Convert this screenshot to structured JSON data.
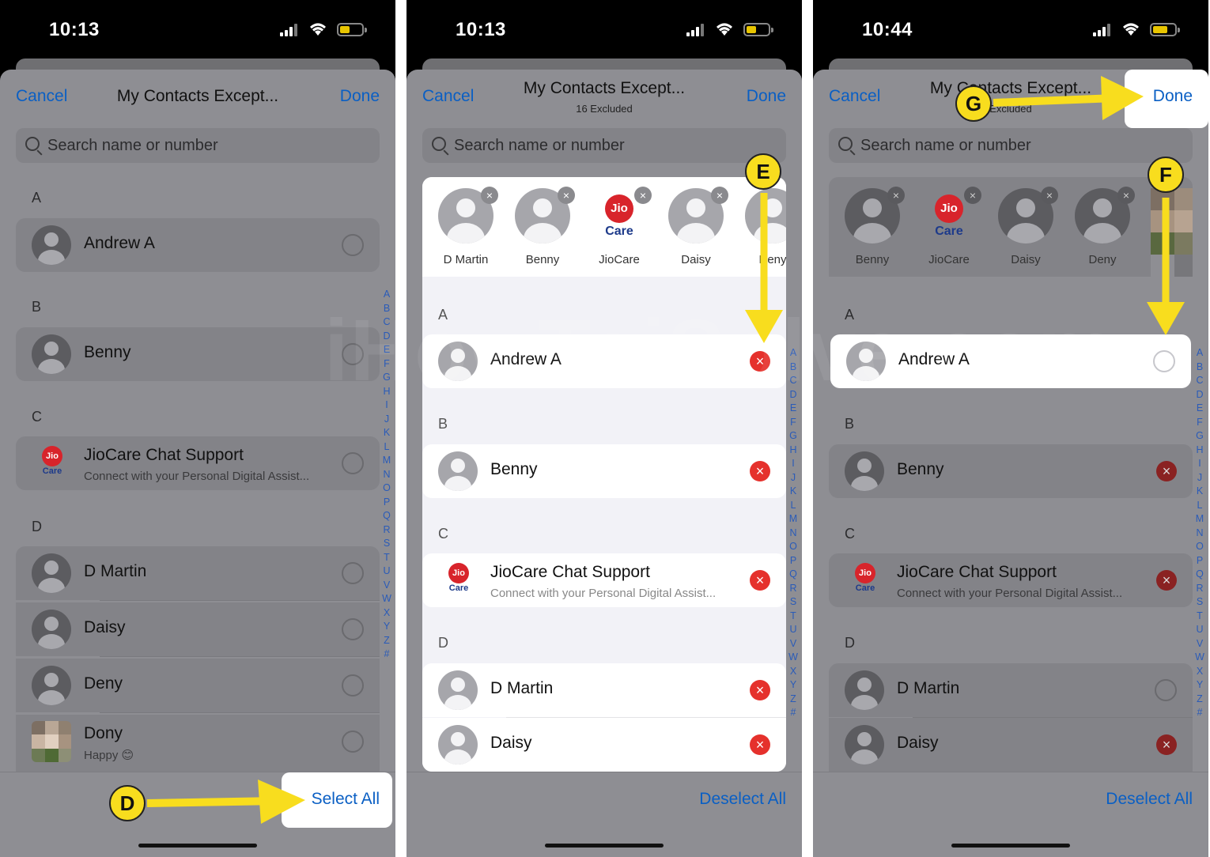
{
  "status_bar": {
    "panel1_time": "10:13",
    "panel2_time": "10:13",
    "panel3_time": "10:44"
  },
  "nav": {
    "cancel": "Cancel",
    "title": "My Contacts Except...",
    "done": "Done",
    "excluded_subtitle": "16 Excluded",
    "excluded_subtitle_partial": "Excluded"
  },
  "search": {
    "placeholder": "Search name or number"
  },
  "sections": [
    "A",
    "B",
    "C",
    "D"
  ],
  "contacts": {
    "andrew": "Andrew A",
    "benny": "Benny",
    "jiocare": "JioCare Chat Support",
    "jiocare_sub": "Connect with your Personal Digital Assist...",
    "dmartin": "D Martin",
    "daisy": "Daisy",
    "deny": "Deny",
    "dony": "Dony",
    "dony_sub": "Happy 😊"
  },
  "jio_logo": {
    "top": "Jio",
    "bottom": "Care"
  },
  "excluded_chips": {
    "panel2": [
      "D Martin",
      "Benny",
      "JioCare",
      "Daisy",
      "Deny"
    ],
    "panel3": [
      "Benny",
      "JioCare",
      "Daisy",
      "Deny"
    ]
  },
  "alphabet_index": [
    "A",
    "B",
    "C",
    "D",
    "E",
    "F",
    "G",
    "H",
    "I",
    "J",
    "K",
    "L",
    "M",
    "N",
    "O",
    "P",
    "Q",
    "R",
    "S",
    "T",
    "U",
    "V",
    "W",
    "X",
    "Y",
    "Z",
    "#"
  ],
  "bottom": {
    "select_all": "Select All",
    "deselect_all": "Deselect All"
  },
  "markers": {
    "d": "D",
    "e": "E",
    "f": "F",
    "g": "G"
  },
  "watermark": "iHowToiSolve.com",
  "colors": {
    "accent": "#0a5fc4",
    "marker": "#f8dd1e",
    "remove_red": "#e5312c",
    "jio_red": "#d8242b"
  },
  "icons": {
    "remove": "×",
    "search": "magnifier",
    "avatar": "person-silhouette"
  }
}
